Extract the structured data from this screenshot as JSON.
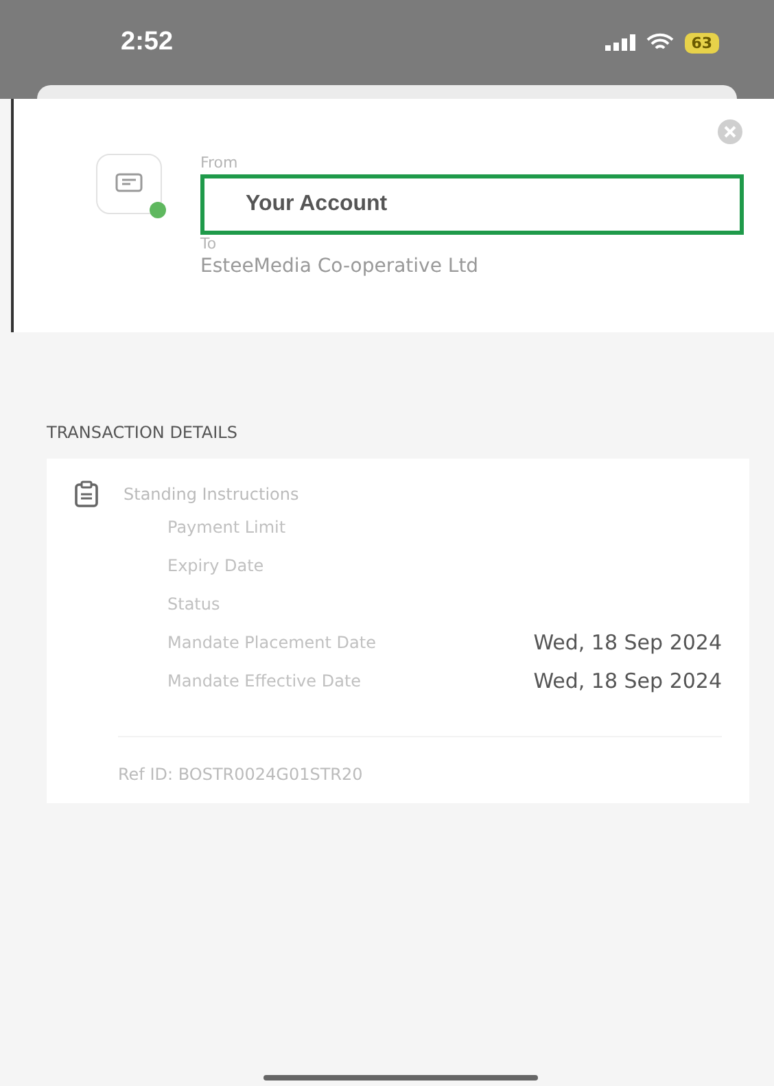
{
  "status_bar": {
    "time": "2:52",
    "battery": "63"
  },
  "transfer": {
    "from_label": "From",
    "from_value": "Your Account",
    "to_label": "To",
    "to_value": "EsteeMedia Co-operative Ltd"
  },
  "section_title": "TRANSACTION DETAILS",
  "details": {
    "title": "Standing Instructions",
    "rows": [
      {
        "label": "Payment Limit"
      },
      {
        "label": "Expiry Date"
      },
      {
        "label": "Status"
      },
      {
        "label": "Mandate Placement Date",
        "value": "Wed, 18 Sep 2024"
      },
      {
        "label": "Mandate Effective Date",
        "value": "Wed, 18 Sep 2024"
      }
    ]
  },
  "ref_id": "Ref ID: BOSTR0024G01STR20"
}
